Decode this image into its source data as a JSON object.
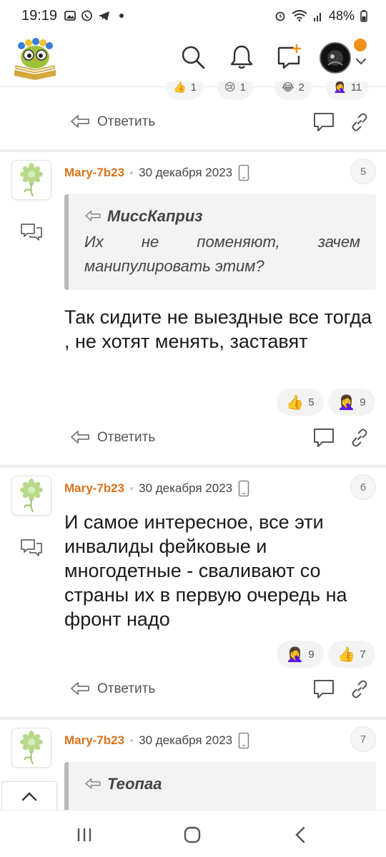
{
  "status_bar": {
    "time": "19:19",
    "battery": "48%"
  },
  "header": {
    "logo_icon": "owl-book-logo",
    "search_icon": "search-icon",
    "bell_icon": "bell-icon",
    "new_post_icon": "new-post-icon",
    "notification_color": "#f0901c"
  },
  "top_reactions": [
    {
      "emoji": "👍",
      "count": "1"
    },
    {
      "emoji": "😢",
      "count": "1"
    },
    {
      "emoji": "😂",
      "count": "2"
    },
    {
      "emoji": "🤦‍♀️",
      "count": "11"
    }
  ],
  "reply_label": "Ответить",
  "comments": [
    {
      "author": "Mary-7b23",
      "date": "30 декабря 2023",
      "number": "5",
      "quote": {
        "author": "МиссКаприз",
        "text": "Их не поменяют, зачем манипулировать этим?"
      },
      "text": "Так сидите не выездные все тогда , не хотят менять, заставят",
      "reactions": [
        {
          "emoji": "👍",
          "count": "5"
        },
        {
          "emoji": "🤦‍♀️",
          "count": "9"
        }
      ]
    },
    {
      "author": "Mary-7b23",
      "date": "30 декабря 2023",
      "number": "6",
      "text": "И самое интересное, все эти инвалиды фейковые и многодетные - сваливают со страны их в первую очередь на фронт надо",
      "reactions": [
        {
          "emoji": "🤦‍♀️",
          "count": "9"
        },
        {
          "emoji": "👍",
          "count": "7"
        }
      ]
    },
    {
      "author": "Mary-7b23",
      "date": "30 декабря 2023",
      "number": "7",
      "quote": {
        "author": "Теопаа",
        "text": ""
      }
    }
  ],
  "colors": {
    "author": "#d9731d",
    "quote_border": "#b9b9b9",
    "quote_bg": "#f3f3f3"
  }
}
